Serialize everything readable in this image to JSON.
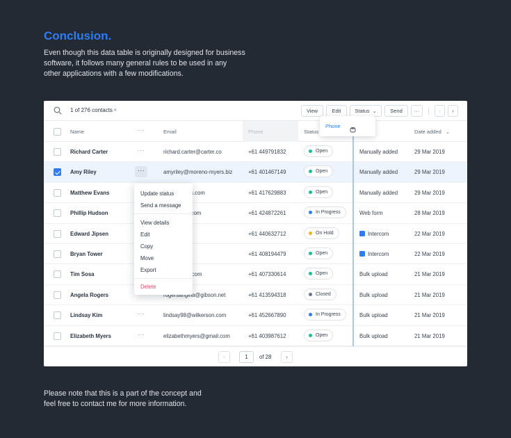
{
  "intro": {
    "title": "Conclusion.",
    "description": "Even though this data table is originally designed for business software, it follows many general rules to be used in any other applications with a few modifications."
  },
  "footer_note": "Please note that this is a part of the concept and feel free to contact me for more information.",
  "toolbar": {
    "selection_count": "1 of 276 contacts",
    "clear_glyph": "×",
    "view_label": "View",
    "edit_label": "Edit",
    "status_label": "Status",
    "send_label": "Send",
    "more_glyph": "···",
    "prev_glyph": "‹",
    "next_glyph": "›"
  },
  "column_menu": {
    "option": "Phone"
  },
  "columns": {
    "name": "Name",
    "email": "Email",
    "phone": "Phone",
    "status": "Status",
    "date": "Date added"
  },
  "rows": [
    {
      "name": "Richard Carter",
      "email": "richard.carter@carter.co",
      "phone": "+61 449791832",
      "status": "Open",
      "source": "Manually added",
      "date": "29 Mar 2019",
      "checked": false
    },
    {
      "name": "Amy Riley",
      "email": "amyriley@moreno-myers.biz",
      "phone": "+61 401467149",
      "status": "Open",
      "source": "Manually added",
      "date": "29 Mar 2019",
      "checked": true
    },
    {
      "name": "Matthew Evans",
      "email": "ew@holmes.com",
      "phone": "+61 417629883",
      "status": "Open",
      "source": "Manually added",
      "date": "29 Mar 2019",
      "checked": false
    },
    {
      "name": "Phillip Hudson",
      "email": "n@hotmail.com",
      "phone": "+61 424872261",
      "status": "In Progress",
      "source": "Web form",
      "date": "28 Mar 2019",
      "checked": false
    },
    {
      "name": "Edward Jipsen",
      "email": "nline.net",
      "phone": "+61 440632712",
      "status": "On Hold",
      "source": "Intercom",
      "date": "22 Mar 2019",
      "checked": false
    },
    {
      "name": "Bryan Tower",
      "email": "cglobal.net",
      "phone": "+61 408194479",
      "status": "Open",
      "source": "Intercom",
      "date": "22 Mar 2019",
      "checked": false
    },
    {
      "name": "Tim Sosa",
      "email": "@swanson.com",
      "phone": "+61 407330614",
      "status": "Open",
      "source": "Bulk upload",
      "date": "21 Mar 2019",
      "checked": false
    },
    {
      "name": "Angela Rogers",
      "email": "rogersangela@gibson.net",
      "phone": "+61 413594318",
      "status": "Closed",
      "source": "Bulk upload",
      "date": "21 Mar 2019",
      "checked": false
    },
    {
      "name": "Lindsay Kim",
      "email": "lindsay98@wilkerson.com",
      "phone": "+61 452667890",
      "status": "In Progress",
      "source": "Bulk upload",
      "date": "21 Mar 2019",
      "checked": false
    },
    {
      "name": "Elizabeth Myers",
      "email": "elizabethmyers@gmail.com",
      "phone": "+61 403987612",
      "status": "Open",
      "source": "Bulk upload",
      "date": "21 Mar 2019",
      "checked": false
    }
  ],
  "status_colors": {
    "Open": "#1fbf8f",
    "In Progress": "#2f7cf6",
    "On Hold": "#f5b21b",
    "Closed": "#6b7685"
  },
  "source_icons": {
    "Intercom": "intercom-icon"
  },
  "row_menu": {
    "group1": [
      "Update status",
      "Send a message"
    ],
    "group2": [
      "View details",
      "Edit",
      "Copy",
      "Move",
      "Export"
    ],
    "danger": "Delete"
  },
  "pagination": {
    "current_page": "1",
    "of_label": "of 28",
    "prev_glyph": "‹",
    "next_glyph": "›"
  },
  "colors": {
    "accent": "#2f7cf6",
    "background": "#232a34",
    "danger": "#e54a6a"
  }
}
